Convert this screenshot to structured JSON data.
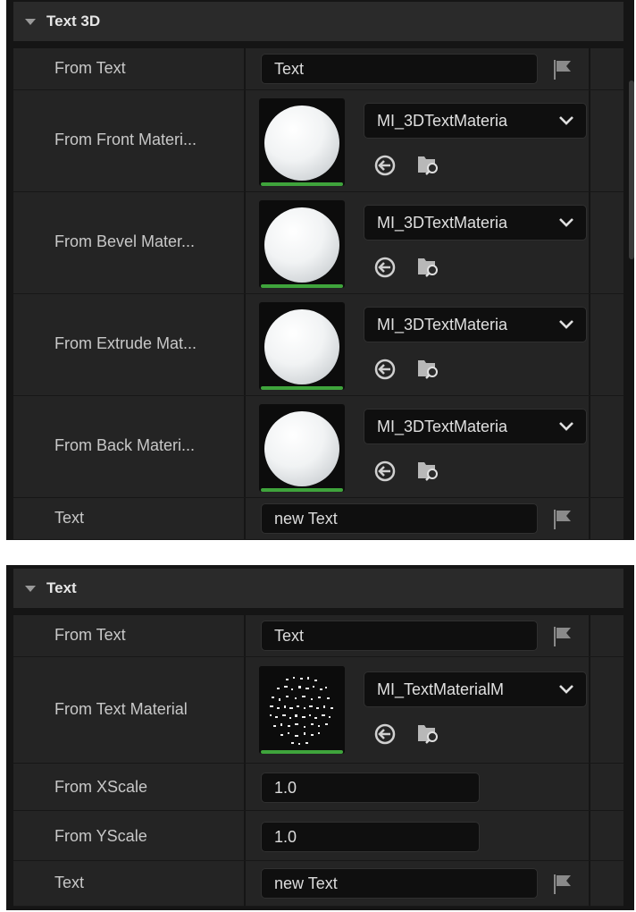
{
  "panel_top": {
    "section_title": "Text 3D",
    "rows": {
      "from_text_label": "From Text",
      "from_text_value": "Text",
      "front_label": "From Front Materi...",
      "front_value": "MI_3DTextMateria",
      "bevel_label": "From Bevel Mater...",
      "bevel_value": "MI_3DTextMateria",
      "extrude_label": "From Extrude Mat...",
      "extrude_value": "MI_3DTextMateria",
      "back_label": "From Back Materi...",
      "back_value": "MI_3DTextMateria",
      "text_label": "Text",
      "text_value": "new Text"
    }
  },
  "panel_bottom": {
    "section_title": "Text",
    "rows": {
      "from_text_label": "From Text",
      "from_text_value": "Text",
      "material_label": "From Text Material",
      "material_value": "MI_TextMaterialM",
      "xscale_label": "From XScale",
      "xscale_value": "1.0",
      "yscale_label": "From YScale",
      "yscale_value": "1.0",
      "text_label": "Text",
      "text_value": "new Text"
    }
  },
  "icons": {
    "expand": "triangle-down-icon",
    "flag": "flag-icon",
    "chevron": "chevron-down-icon",
    "use_selected": "arrow-left-circle-icon",
    "browse": "folder-search-icon"
  },
  "colors": {
    "panel_bg": "#151515",
    "row_bg": "#242424",
    "header_bg": "#2a2a2a",
    "field_bg": "#0f0f0f",
    "accent_green": "#3fa43c"
  }
}
